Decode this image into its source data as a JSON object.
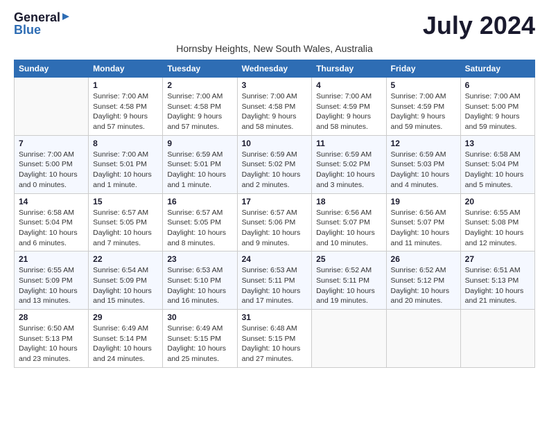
{
  "logo": {
    "general": "General",
    "blue": "Blue"
  },
  "title": "July 2024",
  "subtitle": "Hornsby Heights, New South Wales, Australia",
  "headers": [
    "Sunday",
    "Monday",
    "Tuesday",
    "Wednesday",
    "Thursday",
    "Friday",
    "Saturday"
  ],
  "weeks": [
    [
      {
        "day": "",
        "sunrise": "",
        "sunset": "",
        "daylight": ""
      },
      {
        "day": "1",
        "sunrise": "Sunrise: 7:00 AM",
        "sunset": "Sunset: 4:58 PM",
        "daylight": "Daylight: 9 hours and 57 minutes."
      },
      {
        "day": "2",
        "sunrise": "Sunrise: 7:00 AM",
        "sunset": "Sunset: 4:58 PM",
        "daylight": "Daylight: 9 hours and 57 minutes."
      },
      {
        "day": "3",
        "sunrise": "Sunrise: 7:00 AM",
        "sunset": "Sunset: 4:58 PM",
        "daylight": "Daylight: 9 hours and 58 minutes."
      },
      {
        "day": "4",
        "sunrise": "Sunrise: 7:00 AM",
        "sunset": "Sunset: 4:59 PM",
        "daylight": "Daylight: 9 hours and 58 minutes."
      },
      {
        "day": "5",
        "sunrise": "Sunrise: 7:00 AM",
        "sunset": "Sunset: 4:59 PM",
        "daylight": "Daylight: 9 hours and 59 minutes."
      },
      {
        "day": "6",
        "sunrise": "Sunrise: 7:00 AM",
        "sunset": "Sunset: 5:00 PM",
        "daylight": "Daylight: 9 hours and 59 minutes."
      }
    ],
    [
      {
        "day": "7",
        "sunrise": "Sunrise: 7:00 AM",
        "sunset": "Sunset: 5:00 PM",
        "daylight": "Daylight: 10 hours and 0 minutes."
      },
      {
        "day": "8",
        "sunrise": "Sunrise: 7:00 AM",
        "sunset": "Sunset: 5:01 PM",
        "daylight": "Daylight: 10 hours and 1 minute."
      },
      {
        "day": "9",
        "sunrise": "Sunrise: 6:59 AM",
        "sunset": "Sunset: 5:01 PM",
        "daylight": "Daylight: 10 hours and 1 minute."
      },
      {
        "day": "10",
        "sunrise": "Sunrise: 6:59 AM",
        "sunset": "Sunset: 5:02 PM",
        "daylight": "Daylight: 10 hours and 2 minutes."
      },
      {
        "day": "11",
        "sunrise": "Sunrise: 6:59 AM",
        "sunset": "Sunset: 5:02 PM",
        "daylight": "Daylight: 10 hours and 3 minutes."
      },
      {
        "day": "12",
        "sunrise": "Sunrise: 6:59 AM",
        "sunset": "Sunset: 5:03 PM",
        "daylight": "Daylight: 10 hours and 4 minutes."
      },
      {
        "day": "13",
        "sunrise": "Sunrise: 6:58 AM",
        "sunset": "Sunset: 5:04 PM",
        "daylight": "Daylight: 10 hours and 5 minutes."
      }
    ],
    [
      {
        "day": "14",
        "sunrise": "Sunrise: 6:58 AM",
        "sunset": "Sunset: 5:04 PM",
        "daylight": "Daylight: 10 hours and 6 minutes."
      },
      {
        "day": "15",
        "sunrise": "Sunrise: 6:57 AM",
        "sunset": "Sunset: 5:05 PM",
        "daylight": "Daylight: 10 hours and 7 minutes."
      },
      {
        "day": "16",
        "sunrise": "Sunrise: 6:57 AM",
        "sunset": "Sunset: 5:05 PM",
        "daylight": "Daylight: 10 hours and 8 minutes."
      },
      {
        "day": "17",
        "sunrise": "Sunrise: 6:57 AM",
        "sunset": "Sunset: 5:06 PM",
        "daylight": "Daylight: 10 hours and 9 minutes."
      },
      {
        "day": "18",
        "sunrise": "Sunrise: 6:56 AM",
        "sunset": "Sunset: 5:07 PM",
        "daylight": "Daylight: 10 hours and 10 minutes."
      },
      {
        "day": "19",
        "sunrise": "Sunrise: 6:56 AM",
        "sunset": "Sunset: 5:07 PM",
        "daylight": "Daylight: 10 hours and 11 minutes."
      },
      {
        "day": "20",
        "sunrise": "Sunrise: 6:55 AM",
        "sunset": "Sunset: 5:08 PM",
        "daylight": "Daylight: 10 hours and 12 minutes."
      }
    ],
    [
      {
        "day": "21",
        "sunrise": "Sunrise: 6:55 AM",
        "sunset": "Sunset: 5:09 PM",
        "daylight": "Daylight: 10 hours and 13 minutes."
      },
      {
        "day": "22",
        "sunrise": "Sunrise: 6:54 AM",
        "sunset": "Sunset: 5:09 PM",
        "daylight": "Daylight: 10 hours and 15 minutes."
      },
      {
        "day": "23",
        "sunrise": "Sunrise: 6:53 AM",
        "sunset": "Sunset: 5:10 PM",
        "daylight": "Daylight: 10 hours and 16 minutes."
      },
      {
        "day": "24",
        "sunrise": "Sunrise: 6:53 AM",
        "sunset": "Sunset: 5:11 PM",
        "daylight": "Daylight: 10 hours and 17 minutes."
      },
      {
        "day": "25",
        "sunrise": "Sunrise: 6:52 AM",
        "sunset": "Sunset: 5:11 PM",
        "daylight": "Daylight: 10 hours and 19 minutes."
      },
      {
        "day": "26",
        "sunrise": "Sunrise: 6:52 AM",
        "sunset": "Sunset: 5:12 PM",
        "daylight": "Daylight: 10 hours and 20 minutes."
      },
      {
        "day": "27",
        "sunrise": "Sunrise: 6:51 AM",
        "sunset": "Sunset: 5:13 PM",
        "daylight": "Daylight: 10 hours and 21 minutes."
      }
    ],
    [
      {
        "day": "28",
        "sunrise": "Sunrise: 6:50 AM",
        "sunset": "Sunset: 5:13 PM",
        "daylight": "Daylight: 10 hours and 23 minutes."
      },
      {
        "day": "29",
        "sunrise": "Sunrise: 6:49 AM",
        "sunset": "Sunset: 5:14 PM",
        "daylight": "Daylight: 10 hours and 24 minutes."
      },
      {
        "day": "30",
        "sunrise": "Sunrise: 6:49 AM",
        "sunset": "Sunset: 5:15 PM",
        "daylight": "Daylight: 10 hours and 25 minutes."
      },
      {
        "day": "31",
        "sunrise": "Sunrise: 6:48 AM",
        "sunset": "Sunset: 5:15 PM",
        "daylight": "Daylight: 10 hours and 27 minutes."
      },
      {
        "day": "",
        "sunrise": "",
        "sunset": "",
        "daylight": ""
      },
      {
        "day": "",
        "sunrise": "",
        "sunset": "",
        "daylight": ""
      },
      {
        "day": "",
        "sunrise": "",
        "sunset": "",
        "daylight": ""
      }
    ]
  ]
}
